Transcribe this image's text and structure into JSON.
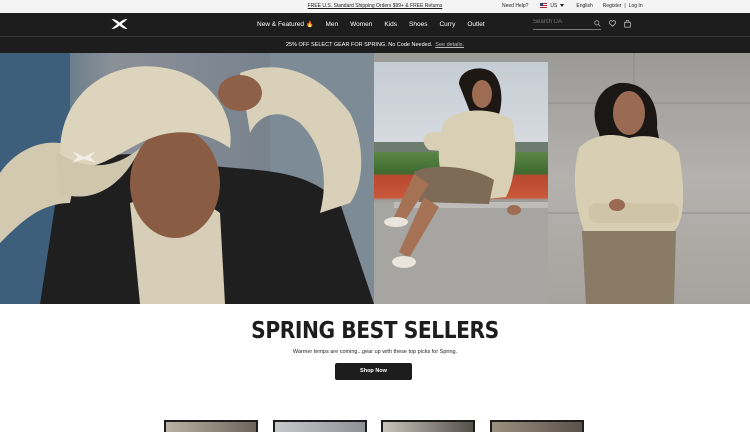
{
  "utility": {
    "promo": "FREE U.S. Standard Shipping Orders $99+ & FREE Returns",
    "help": "Need Help?",
    "country": "US",
    "language": "English",
    "register": "Register",
    "divider": "|",
    "login": "Log In"
  },
  "nav": {
    "logo": "Under Armour",
    "items": [
      {
        "label": "New & Featured"
      },
      {
        "label": "Men"
      },
      {
        "label": "Women"
      },
      {
        "label": "Kids"
      },
      {
        "label": "Shoes"
      },
      {
        "label": "Curry"
      },
      {
        "label": "Outlet"
      }
    ],
    "search_placeholder": "Search UA"
  },
  "promo_bar": {
    "text": "25% OFF SELECT GEAR FOR SPRING. No Code Needed.",
    "link": "See details."
  },
  "hero": {
    "headline": "SPRING BEST SELLERS",
    "subtext": "Warmer temps are coming...gear up with these top picks for Spring.",
    "cta": "Shop Now"
  },
  "colors": {
    "nav_bg": "#1d1d1d",
    "accent_fire": "#ff7a00"
  }
}
